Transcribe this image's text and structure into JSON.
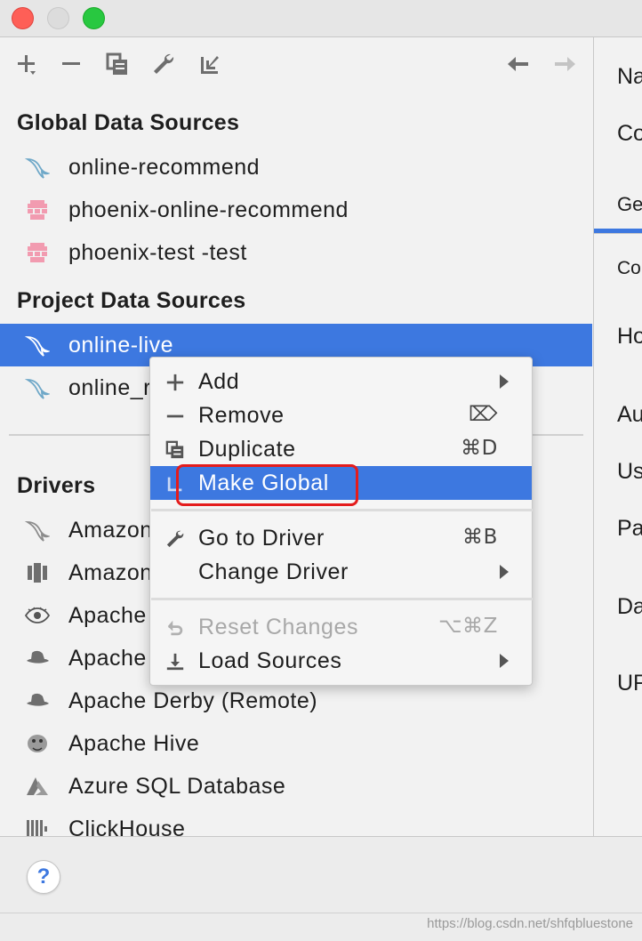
{
  "window": {
    "traffic_lights": [
      "close",
      "minimize",
      "maximize"
    ]
  },
  "toolbar": {
    "icons": [
      "add-icon",
      "remove-icon",
      "duplicate-icon",
      "wrench-icon",
      "make-global-icon",
      "back-arrow-icon",
      "forward-arrow-icon"
    ]
  },
  "global_sources": {
    "title": "Global Data Sources",
    "items": [
      {
        "label": "online-recommend",
        "icon": "mysql-icon"
      },
      {
        "label": "phoenix-online-recommend",
        "icon": "phoenix-icon"
      },
      {
        "label": "phoenix-test -test",
        "icon": "phoenix-icon"
      }
    ]
  },
  "project_sources": {
    "title": "Project Data Sources",
    "items": [
      {
        "label": "online-live",
        "icon": "mysql-icon",
        "selected": true
      },
      {
        "label": "online_r",
        "icon": "mysql-icon"
      }
    ]
  },
  "drivers": {
    "title": "Drivers",
    "items": [
      {
        "label": "Amazon",
        "icon": "mysql-icon"
      },
      {
        "label": "Amazon",
        "icon": "redshift-icon"
      },
      {
        "label": "Apache",
        "icon": "eye-icon"
      },
      {
        "label": "Apache",
        "icon": "hat-icon"
      },
      {
        "label": "Apache Derby (Remote)",
        "icon": "hat-icon"
      },
      {
        "label": "Apache Hive",
        "icon": "hive-icon"
      },
      {
        "label": "Azure SQL Database",
        "icon": "azure-icon"
      },
      {
        "label": "ClickHouse",
        "icon": "clickhouse-icon"
      }
    ]
  },
  "right_panel": {
    "labels": [
      "Na",
      "Co",
      "Ge",
      "Co",
      "Ho",
      "Au",
      "Us",
      "Pa",
      "Da",
      "UF"
    ]
  },
  "context_menu": {
    "items": [
      {
        "label": "Add",
        "icon": "plus-icon",
        "shortcut": "",
        "submenu": true
      },
      {
        "label": "Remove",
        "icon": "minus-icon",
        "shortcut": "⌦",
        "submenu": false
      },
      {
        "label": "Duplicate",
        "icon": "duplicate-icon",
        "shortcut": "⌘D",
        "submenu": false
      },
      {
        "label": "Make Global",
        "icon": "make-global-icon",
        "shortcut": "",
        "submenu": false,
        "active": true
      },
      {
        "label": "Go to Driver",
        "icon": "wrench-icon",
        "shortcut": "⌘B",
        "submenu": false
      },
      {
        "label": "Change Driver",
        "icon": "",
        "shortcut": "",
        "submenu": true
      },
      {
        "label": "Reset Changes",
        "icon": "undo-icon",
        "shortcut": "⌥⌘Z",
        "submenu": false,
        "disabled": true
      },
      {
        "label": "Load Sources",
        "icon": "download-icon",
        "shortcut": "",
        "submenu": true
      }
    ]
  },
  "bottom": {
    "help": "?",
    "watermark": "https://blog.csdn.net/shfqbluestone"
  },
  "colors": {
    "selection": "#3d78e0",
    "highlight_box": "#e41c1c"
  }
}
